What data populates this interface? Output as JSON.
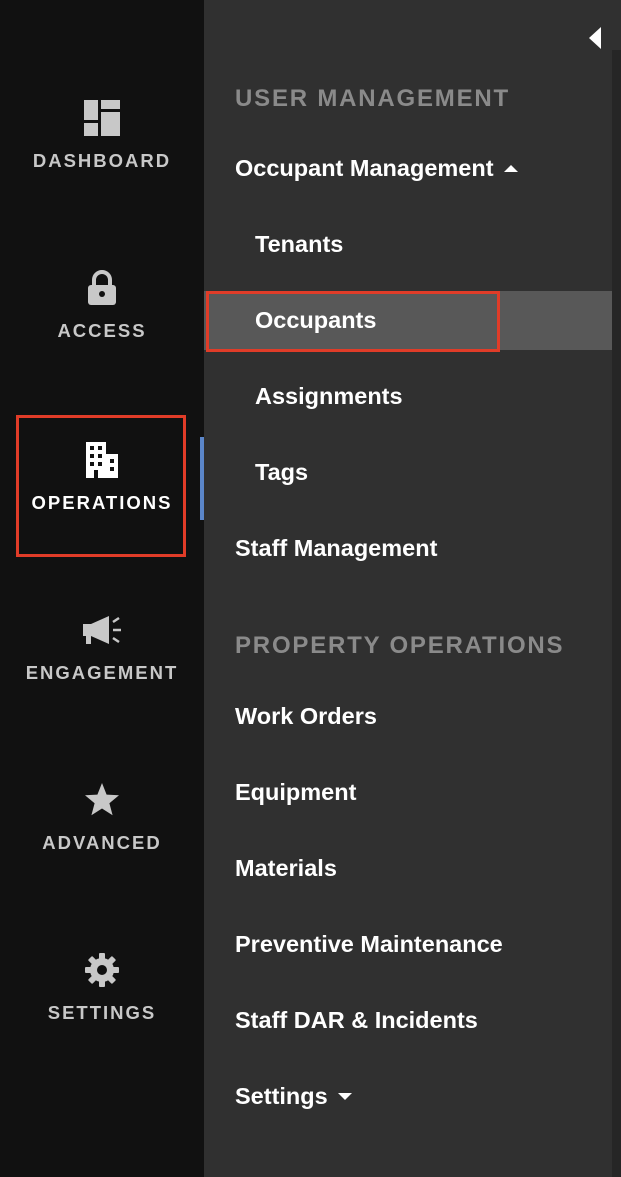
{
  "rail": {
    "items": [
      {
        "label": "DASHBOARD",
        "icon": "dashboard-icon"
      },
      {
        "label": "ACCESS",
        "icon": "lock-icon"
      },
      {
        "label": "OPERATIONS",
        "icon": "building-icon"
      },
      {
        "label": "ENGAGEMENT",
        "icon": "megaphone-icon"
      },
      {
        "label": "ADVANCED",
        "icon": "star-icon"
      },
      {
        "label": "SETTINGS",
        "icon": "gear-icon"
      }
    ],
    "active_index": 2
  },
  "panel": {
    "collapse_icon": "caret-left-icon",
    "sections": [
      {
        "title": "USER MANAGEMENT",
        "items": [
          {
            "label": "Occupant Management",
            "expanded": true,
            "children": [
              "Tenants",
              "Occupants",
              "Assignments",
              "Tags"
            ],
            "selected_child": "Occupants"
          },
          {
            "label": "Staff Management"
          }
        ]
      },
      {
        "title": "PROPERTY OPERATIONS",
        "items": [
          {
            "label": "Work Orders"
          },
          {
            "label": "Equipment"
          },
          {
            "label": "Materials"
          },
          {
            "label": "Preventive Maintenance"
          },
          {
            "label": "Staff DAR & Incidents"
          },
          {
            "label": "Settings",
            "expanded": false
          }
        ]
      }
    ]
  },
  "colors": {
    "rail_bg": "#111111",
    "panel_bg": "#303030",
    "selected_bg": "#585858",
    "highlight_border": "#e03c28",
    "active_indicator": "#5b86c9",
    "section_title": "#8a8a8a"
  }
}
